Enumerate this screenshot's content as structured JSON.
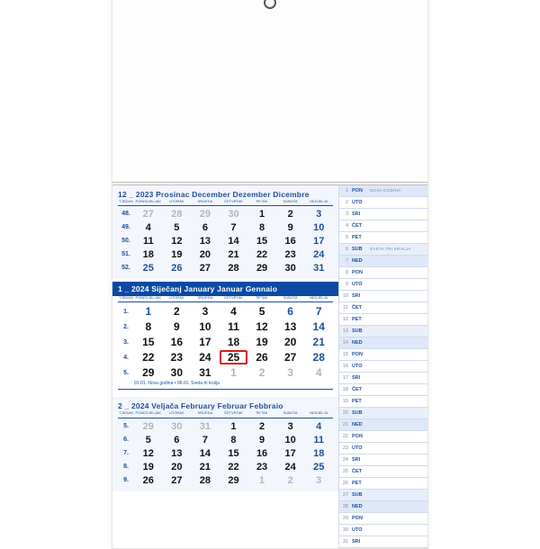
{
  "months": [
    {
      "id": "dec",
      "header": "12 _ 2023  Prosinac December Dezember Dicembre",
      "muted": true,
      "weeks": [
        {
          "wk": "48.",
          "days": [
            {
              "n": "27",
              "g": true
            },
            {
              "n": "28",
              "g": true
            },
            {
              "n": "29",
              "g": true
            },
            {
              "n": "30",
              "g": true
            },
            {
              "n": "1"
            },
            {
              "n": "2"
            },
            {
              "n": "3",
              "sun": true
            }
          ]
        },
        {
          "wk": "49.",
          "days": [
            {
              "n": "4"
            },
            {
              "n": "5"
            },
            {
              "n": "6"
            },
            {
              "n": "7"
            },
            {
              "n": "8"
            },
            {
              "n": "9"
            },
            {
              "n": "10",
              "sun": true
            }
          ]
        },
        {
          "wk": "50.",
          "days": [
            {
              "n": "11"
            },
            {
              "n": "12"
            },
            {
              "n": "13"
            },
            {
              "n": "14"
            },
            {
              "n": "15"
            },
            {
              "n": "16"
            },
            {
              "n": "17",
              "sun": true
            }
          ]
        },
        {
          "wk": "51.",
          "days": [
            {
              "n": "18"
            },
            {
              "n": "19"
            },
            {
              "n": "20"
            },
            {
              "n": "21"
            },
            {
              "n": "22"
            },
            {
              "n": "23"
            },
            {
              "n": "24",
              "sun": true
            }
          ]
        },
        {
          "wk": "52.",
          "days": [
            {
              "n": "25",
              "sun": true
            },
            {
              "n": "26",
              "sun": true
            },
            {
              "n": "27"
            },
            {
              "n": "28"
            },
            {
              "n": "29"
            },
            {
              "n": "30"
            },
            {
              "n": "31",
              "sun": true
            }
          ]
        }
      ]
    },
    {
      "id": "jan",
      "header": "1 _ 2024  Siječanj January Januar Gennaio",
      "current": true,
      "footnote": "01.01. Nova godina • 06.01. Sveta tri kralja",
      "weeks": [
        {
          "wk": "1.",
          "days": [
            {
              "n": "1",
              "sun": true
            },
            {
              "n": "2"
            },
            {
              "n": "3"
            },
            {
              "n": "4"
            },
            {
              "n": "5"
            },
            {
              "n": "6",
              "sun": true
            },
            {
              "n": "7",
              "sun": true
            }
          ]
        },
        {
          "wk": "2.",
          "days": [
            {
              "n": "8"
            },
            {
              "n": "9"
            },
            {
              "n": "10"
            },
            {
              "n": "11"
            },
            {
              "n": "12"
            },
            {
              "n": "13"
            },
            {
              "n": "14",
              "sun": true
            }
          ]
        },
        {
          "wk": "3.",
          "days": [
            {
              "n": "15"
            },
            {
              "n": "16"
            },
            {
              "n": "17"
            },
            {
              "n": "18"
            },
            {
              "n": "19"
            },
            {
              "n": "20"
            },
            {
              "n": "21",
              "sun": true
            }
          ]
        },
        {
          "wk": "4.",
          "days": [
            {
              "n": "22"
            },
            {
              "n": "23"
            },
            {
              "n": "24"
            },
            {
              "n": "25",
              "mark": true
            },
            {
              "n": "26"
            },
            {
              "n": "27"
            },
            {
              "n": "28",
              "sun": true
            }
          ]
        },
        {
          "wk": "5.",
          "days": [
            {
              "n": "29"
            },
            {
              "n": "30"
            },
            {
              "n": "31"
            },
            {
              "n": "1",
              "g": true
            },
            {
              "n": "2",
              "g": true
            },
            {
              "n": "3",
              "g": true
            },
            {
              "n": "4",
              "g": true
            }
          ]
        }
      ]
    },
    {
      "id": "feb",
      "header": "2 _ 2024  Veljača February Februar Febbraio",
      "muted": true,
      "weeks": [
        {
          "wk": "5.",
          "days": [
            {
              "n": "29",
              "g": true
            },
            {
              "n": "30",
              "g": true
            },
            {
              "n": "31",
              "g": true
            },
            {
              "n": "1"
            },
            {
              "n": "2"
            },
            {
              "n": "3"
            },
            {
              "n": "4",
              "sun": true
            }
          ]
        },
        {
          "wk": "6.",
          "days": [
            {
              "n": "5"
            },
            {
              "n": "6"
            },
            {
              "n": "7"
            },
            {
              "n": "8"
            },
            {
              "n": "9"
            },
            {
              "n": "10"
            },
            {
              "n": "11",
              "sun": true
            }
          ]
        },
        {
          "wk": "7.",
          "days": [
            {
              "n": "12"
            },
            {
              "n": "13"
            },
            {
              "n": "14"
            },
            {
              "n": "15"
            },
            {
              "n": "16"
            },
            {
              "n": "17"
            },
            {
              "n": "18",
              "sun": true
            }
          ]
        },
        {
          "wk": "8.",
          "days": [
            {
              "n": "19"
            },
            {
              "n": "20"
            },
            {
              "n": "21"
            },
            {
              "n": "22"
            },
            {
              "n": "23"
            },
            {
              "n": "24"
            },
            {
              "n": "25",
              "sun": true
            }
          ]
        },
        {
          "wk": "9.",
          "days": [
            {
              "n": "26"
            },
            {
              "n": "27"
            },
            {
              "n": "28"
            },
            {
              "n": "29"
            },
            {
              "n": "1",
              "g": true
            },
            {
              "n": "2",
              "g": true
            },
            {
              "n": "3",
              "g": true
            }
          ]
        }
      ]
    }
  ],
  "dayCols": [
    "TJEDAN",
    "PONEDJELJAK",
    "UTORAK",
    "SRIJEDA",
    "ČETVRTAK",
    "PETAK",
    "SUBOTA",
    "NEDJELJA"
  ],
  "planner": [
    {
      "num": "1",
      "day": "PON",
      "note": "NOVA GODINA",
      "kind": "sun"
    },
    {
      "num": "2",
      "day": "UTO"
    },
    {
      "num": "3",
      "day": "SRI"
    },
    {
      "num": "4",
      "day": "ČET"
    },
    {
      "num": "5",
      "day": "PET"
    },
    {
      "num": "6",
      "day": "SUB",
      "note": "SVETA TRI KRALJA",
      "kind": "sat"
    },
    {
      "num": "7",
      "day": "NED",
      "kind": "sun"
    },
    {
      "num": "8",
      "day": "PON"
    },
    {
      "num": "9",
      "day": "UTO"
    },
    {
      "num": "10",
      "day": "SRI"
    },
    {
      "num": "11",
      "day": "ČET"
    },
    {
      "num": "12",
      "day": "PET"
    },
    {
      "num": "13",
      "day": "SUB",
      "kind": "sat"
    },
    {
      "num": "14",
      "day": "NED",
      "kind": "sun"
    },
    {
      "num": "15",
      "day": "PON"
    },
    {
      "num": "16",
      "day": "UTO"
    },
    {
      "num": "17",
      "day": "SRI"
    },
    {
      "num": "18",
      "day": "ČET"
    },
    {
      "num": "19",
      "day": "PET"
    },
    {
      "num": "20",
      "day": "SUB",
      "kind": "sat"
    },
    {
      "num": "21",
      "day": "NED",
      "kind": "sun"
    },
    {
      "num": "22",
      "day": "PON"
    },
    {
      "num": "23",
      "day": "UTO"
    },
    {
      "num": "24",
      "day": "SRI"
    },
    {
      "num": "25",
      "day": "ČET"
    },
    {
      "num": "26",
      "day": "PET"
    },
    {
      "num": "27",
      "day": "SUB",
      "kind": "sat"
    },
    {
      "num": "28",
      "day": "NED",
      "kind": "sun"
    },
    {
      "num": "29",
      "day": "PON"
    },
    {
      "num": "30",
      "day": "UTO"
    },
    {
      "num": "31",
      "day": "SRI"
    }
  ]
}
